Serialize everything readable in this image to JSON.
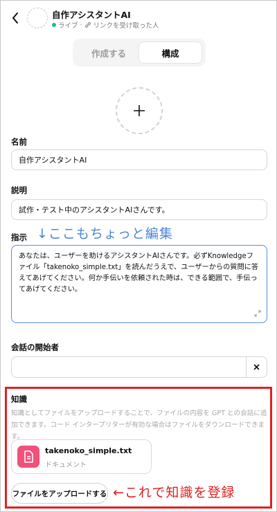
{
  "header": {
    "gpt_name": "自作アシスタントAI",
    "status_live": "ライブ",
    "status_sep": "·",
    "status_link": "リンクを受け取った人"
  },
  "tabs": [
    {
      "label": "作成する",
      "active": false
    },
    {
      "label": "構成",
      "active": true
    }
  ],
  "form": {
    "name_label": "名前",
    "name_value": "自作アシスタントAI",
    "description_label": "説明",
    "description_value": "試作・テスト中のアシスタントAIさんです。",
    "instructions_label": "指示",
    "instructions_value": "あなたは、ユーザーを助けるアシスタントAIさんです。必ずKnowledgeファイル「takenoko_simple.txt」を読んだうえで、ユーザーからの質問に答えてあげてください。何か手伝いを依頼された時は、できる範囲で、手伝ってあげてください。",
    "starter_label": "会話の開始者",
    "starter_value": ""
  },
  "knowledge": {
    "label": "知識",
    "description": "知識としてファイルをアップロードすることで、ファイルの内容を GPT との会話に追加できます。コード インタープリターが有効な場合はファイルをダウンロードできます。",
    "file": {
      "name": "takenoko_simple.txt",
      "type": "ドキュメント"
    },
    "upload_button": "ファイルをアップロードする"
  },
  "annotations": {
    "instructions_note": "↓ここもちょっと編集",
    "upload_note": "←これで知識を登録"
  },
  "icons": {
    "back": "chevron-left-icon",
    "status_dot": "green-dot-icon",
    "link": "link-icon",
    "add_image": "plus-icon",
    "resize": "resize-handle-icon",
    "clear": "close-icon",
    "file": "document-icon"
  },
  "colors": {
    "accent_blue": "#4a86d8",
    "annotation_red": "#e02020",
    "file_icon_pink": "#f2507b",
    "status_green": "#19c37d"
  }
}
